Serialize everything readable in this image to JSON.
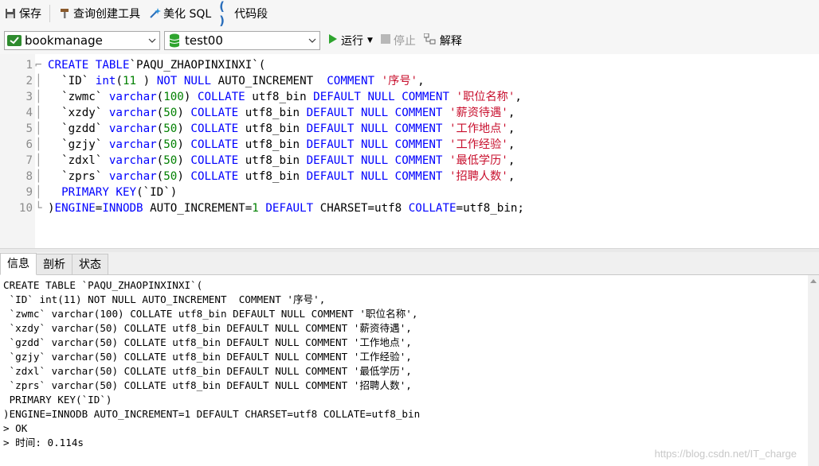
{
  "toolbar": {
    "save_label": "保存",
    "query_builder_label": "查询创建工具",
    "beautify_label": "美化 SQL",
    "snippet_label": "代码段"
  },
  "selectors": {
    "connection": "bookmanage",
    "database": "test00",
    "run_label": "运行",
    "stop_label": "停止",
    "explain_label": "解释"
  },
  "editor": {
    "lines": [
      {
        "n": "1",
        "segs": [
          [
            "kw",
            "CREATE TABLE"
          ],
          [
            "",
            "`PAQU_ZHAOPINXINXI`("
          ]
        ]
      },
      {
        "n": "2",
        "segs": [
          [
            "",
            "  `ID` "
          ],
          [
            "kw",
            "int"
          ],
          [
            "",
            "("
          ],
          [
            "num",
            "11"
          ],
          [
            "",
            " ) "
          ],
          [
            "kw",
            "NOT NULL"
          ],
          [
            "",
            " AUTO_INCREMENT  "
          ],
          [
            "kw",
            "COMMENT"
          ],
          [
            "",
            " "
          ],
          [
            "str",
            "'序号'"
          ],
          [
            "",
            ","
          ]
        ]
      },
      {
        "n": "3",
        "segs": [
          [
            "",
            "  `zwmc` "
          ],
          [
            "kw",
            "varchar"
          ],
          [
            "",
            "("
          ],
          [
            "num",
            "100"
          ],
          [
            "",
            ") "
          ],
          [
            "kw",
            "COLLATE"
          ],
          [
            "",
            " utf8_bin "
          ],
          [
            "kw",
            "DEFAULT NULL COMMENT"
          ],
          [
            "",
            " "
          ],
          [
            "str",
            "'职位名称'"
          ],
          [
            "",
            ","
          ]
        ]
      },
      {
        "n": "4",
        "segs": [
          [
            "",
            "  `xzdy` "
          ],
          [
            "kw",
            "varchar"
          ],
          [
            "",
            "("
          ],
          [
            "num",
            "50"
          ],
          [
            "",
            ") "
          ],
          [
            "kw",
            "COLLATE"
          ],
          [
            "",
            " utf8_bin "
          ],
          [
            "kw",
            "DEFAULT NULL COMMENT"
          ],
          [
            "",
            " "
          ],
          [
            "str",
            "'薪资待遇'"
          ],
          [
            "",
            ","
          ]
        ]
      },
      {
        "n": "5",
        "segs": [
          [
            "",
            "  `gzdd` "
          ],
          [
            "kw",
            "varchar"
          ],
          [
            "",
            "("
          ],
          [
            "num",
            "50"
          ],
          [
            "",
            ") "
          ],
          [
            "kw",
            "COLLATE"
          ],
          [
            "",
            " utf8_bin "
          ],
          [
            "kw",
            "DEFAULT NULL COMMENT"
          ],
          [
            "",
            " "
          ],
          [
            "str",
            "'工作地点'"
          ],
          [
            "",
            ","
          ]
        ]
      },
      {
        "n": "6",
        "segs": [
          [
            "",
            "  `gzjy` "
          ],
          [
            "kw",
            "varchar"
          ],
          [
            "",
            "("
          ],
          [
            "num",
            "50"
          ],
          [
            "",
            ") "
          ],
          [
            "kw",
            "COLLATE"
          ],
          [
            "",
            " utf8_bin "
          ],
          [
            "kw",
            "DEFAULT NULL COMMENT"
          ],
          [
            "",
            " "
          ],
          [
            "str",
            "'工作经验'"
          ],
          [
            "",
            ","
          ]
        ]
      },
      {
        "n": "7",
        "segs": [
          [
            "",
            "  `zdxl` "
          ],
          [
            "kw",
            "varchar"
          ],
          [
            "",
            "("
          ],
          [
            "num",
            "50"
          ],
          [
            "",
            ") "
          ],
          [
            "kw",
            "COLLATE"
          ],
          [
            "",
            " utf8_bin "
          ],
          [
            "kw",
            "DEFAULT NULL COMMENT"
          ],
          [
            "",
            " "
          ],
          [
            "str",
            "'最低学历'"
          ],
          [
            "",
            ","
          ]
        ]
      },
      {
        "n": "8",
        "segs": [
          [
            "",
            "  `zprs` "
          ],
          [
            "kw",
            "varchar"
          ],
          [
            "",
            "("
          ],
          [
            "num",
            "50"
          ],
          [
            "",
            ") "
          ],
          [
            "kw",
            "COLLATE"
          ],
          [
            "",
            " utf8_bin "
          ],
          [
            "kw",
            "DEFAULT NULL COMMENT"
          ],
          [
            "",
            " "
          ],
          [
            "str",
            "'招聘人数'"
          ],
          [
            "",
            ","
          ]
        ]
      },
      {
        "n": "9",
        "segs": [
          [
            "",
            "  "
          ],
          [
            "kw",
            "PRIMARY KEY"
          ],
          [
            "",
            "(`ID`)"
          ]
        ]
      },
      {
        "n": "10",
        "segs": [
          [
            "",
            ")"
          ],
          [
            "kw",
            "ENGINE"
          ],
          [
            "",
            "="
          ],
          [
            "kw",
            "INNODB"
          ],
          [
            "",
            " AUTO_INCREMENT="
          ],
          [
            "num",
            "1"
          ],
          [
            "",
            " "
          ],
          [
            "kw",
            "DEFAULT"
          ],
          [
            "",
            " CHARSET=utf8 "
          ],
          [
            "kw",
            "COLLATE"
          ],
          [
            "",
            "=utf8_bin;"
          ]
        ]
      }
    ]
  },
  "tabs": [
    "信息",
    "剖析",
    "状态"
  ],
  "output": {
    "lines": [
      "CREATE TABLE `PAQU_ZHAOPINXINXI`(",
      " `ID` int(11) NOT NULL AUTO_INCREMENT  COMMENT '序号',",
      " `zwmc` varchar(100) COLLATE utf8_bin DEFAULT NULL COMMENT '职位名称',",
      " `xzdy` varchar(50) COLLATE utf8_bin DEFAULT NULL COMMENT '薪资待遇',",
      " `gzdd` varchar(50) COLLATE utf8_bin DEFAULT NULL COMMENT '工作地点',",
      " `gzjy` varchar(50) COLLATE utf8_bin DEFAULT NULL COMMENT '工作经验',",
      " `zdxl` varchar(50) COLLATE utf8_bin DEFAULT NULL COMMENT '最低学历',",
      " `zprs` varchar(50) COLLATE utf8_bin DEFAULT NULL COMMENT '招聘人数',",
      " PRIMARY KEY(`ID`)",
      ")ENGINE=INNODB AUTO_INCREMENT=1 DEFAULT CHARSET=utf8 COLLATE=utf8_bin",
      "> OK",
      "> 时间: 0.114s"
    ]
  },
  "watermark": "https://blog.csdn.net/IT_charge",
  "icons": {
    "save": "save-icon",
    "query_builder": "hammer-icon",
    "beautify": "magic-wand-icon",
    "snippet": "braces-icon",
    "connection": "connection-icon",
    "database": "database-icon",
    "run": "play-icon",
    "stop": "stop-icon",
    "explain": "explain-icon"
  },
  "colors": {
    "keyword": "#0000ff",
    "string": "#c8102e",
    "number": "#008000",
    "run_green": "#2ea42e"
  }
}
